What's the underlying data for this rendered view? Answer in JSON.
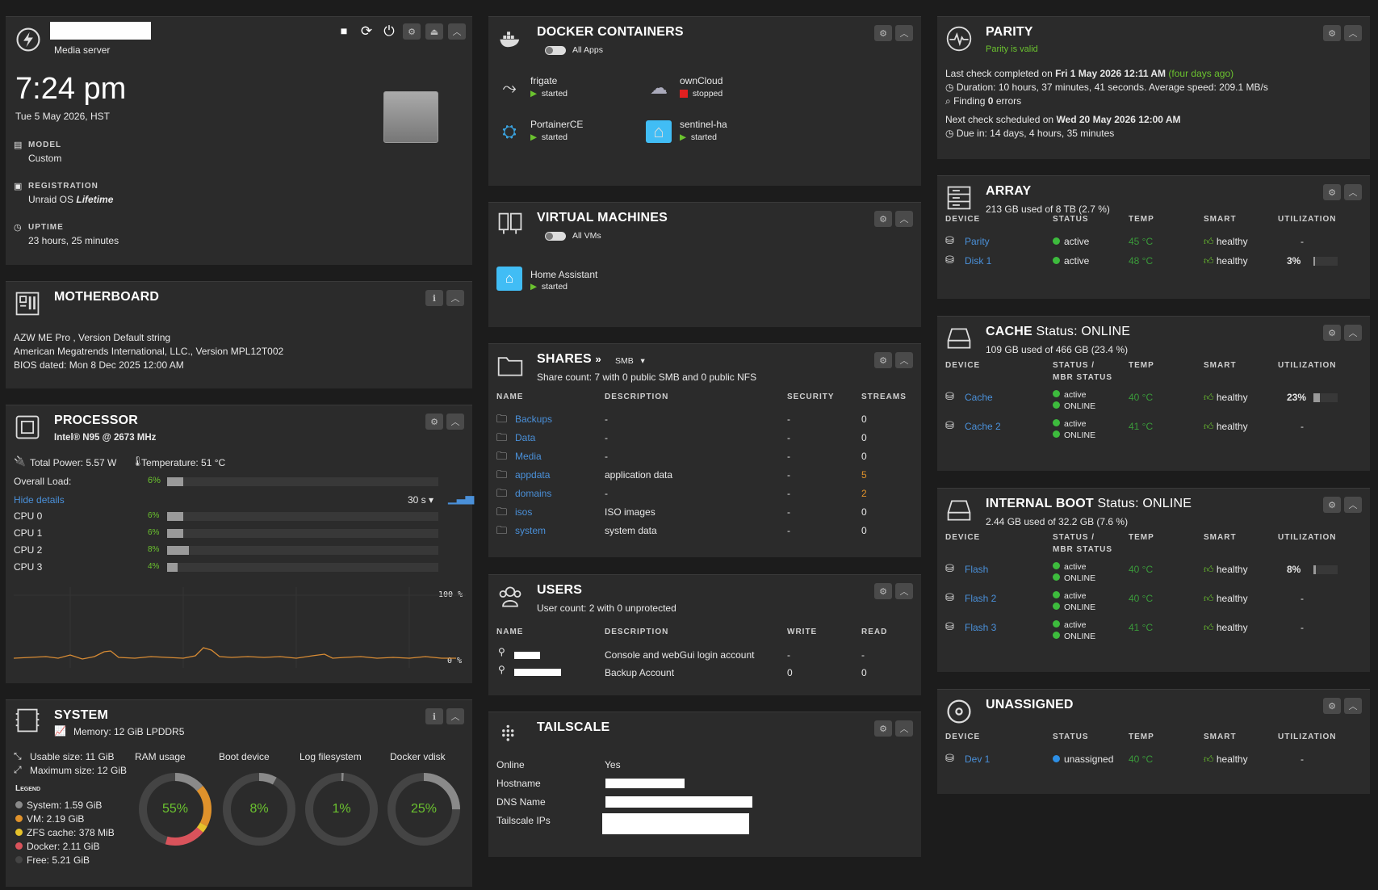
{
  "server": {
    "description": "Media server",
    "time": "7:24 pm",
    "date": "Tue 5 May 2026, HST",
    "model_label": "MODEL",
    "model_value": "Custom",
    "registration_label": "REGISTRATION",
    "registration_value_prefix": "Unraid OS",
    "registration_value_em": "Lifetime",
    "uptime_label": "UPTIME",
    "uptime_value": "23 hours, 25 minutes"
  },
  "motherboard": {
    "title": "MOTHERBOARD",
    "line1": "AZW ME Pro , Version Default string",
    "line2": "American Megatrends International, LLC., Version MPL12T002",
    "line3": "BIOS dated: Mon 8 Dec 2025 12:00 AM"
  },
  "processor": {
    "title": "PROCESSOR",
    "model": "Intel® N95 @ 2673 MHz",
    "power": "Total Power: 5.57 W",
    "temp": "Temperature: 51 °C",
    "overall_label": "Overall Load:",
    "overall_pct": "6%",
    "overall_value": 0.06,
    "hide_details": "Hide details",
    "interval": "30 s ▾",
    "cpus": [
      {
        "label": "CPU 0",
        "pct": "6%",
        "value": 0.06
      },
      {
        "label": "CPU 1",
        "pct": "6%",
        "value": 0.06
      },
      {
        "label": "CPU 2",
        "pct": "8%",
        "value": 0.08
      },
      {
        "label": "CPU 3",
        "pct": "4%",
        "value": 0.04
      }
    ],
    "graph_max": "100 %",
    "graph_min": "0 %"
  },
  "system": {
    "title": "SYSTEM",
    "memory": "Memory: 12 GiB LPDDR5",
    "usable": "Usable size: 11 GiB",
    "maximum": "Maximum size: 12 GiB",
    "legend_title": "Legend",
    "legend": [
      {
        "label": "System: 1.59 GiB",
        "color": "#8a8a8a"
      },
      {
        "label": "VM: 2.19 GiB",
        "color": "#e0922b"
      },
      {
        "label": "ZFS cache: 378 MiB",
        "color": "#e6c22b"
      },
      {
        "label": "Docker: 2.11 GiB",
        "color": "#d9535b"
      },
      {
        "label": "Free: 5.21 GiB",
        "color": "#444444"
      }
    ],
    "gauges": [
      {
        "label": "RAM usage",
        "value": "55%",
        "pct": 0.55
      },
      {
        "label": "Boot device",
        "value": "8%",
        "pct": 0.08
      },
      {
        "label": "Log filesystem",
        "value": "1%",
        "pct": 0.01
      },
      {
        "label": "Docker vdisk",
        "value": "25%",
        "pct": 0.25
      }
    ]
  },
  "docker": {
    "title": "DOCKER CONTAINERS",
    "toggle_label": "All Apps",
    "containers": [
      {
        "name": "frigate",
        "status": "started"
      },
      {
        "name": "ownCloud",
        "status": "stopped"
      },
      {
        "name": "PortainerCE",
        "status": "started"
      },
      {
        "name": "sentinel-ha",
        "status": "started"
      }
    ]
  },
  "vms": {
    "title": "VIRTUAL MACHINES",
    "toggle_label": "All VMs",
    "items": [
      {
        "name": "Home Assistant",
        "status": "started"
      }
    ]
  },
  "shares": {
    "title": "SHARES",
    "protocol": "SMB",
    "count": "Share count: 7 with 0 public SMB and 0 public NFS",
    "headers": [
      "NAME",
      "DESCRIPTION",
      "SECURITY",
      "STREAMS"
    ],
    "rows": [
      {
        "name": "Backups",
        "desc": "-",
        "sec": "-",
        "streams": "0"
      },
      {
        "name": "Data",
        "desc": "-",
        "sec": "-",
        "streams": "0"
      },
      {
        "name": "Media",
        "desc": "-",
        "sec": "-",
        "streams": "0"
      },
      {
        "name": "appdata",
        "desc": "application data",
        "sec": "-",
        "streams": "5"
      },
      {
        "name": "domains",
        "desc": "-",
        "sec": "-",
        "streams": "2"
      },
      {
        "name": "isos",
        "desc": "ISO images",
        "sec": "-",
        "streams": "0"
      },
      {
        "name": "system",
        "desc": "system data",
        "sec": "-",
        "streams": "0"
      }
    ]
  },
  "users": {
    "title": "USERS",
    "count": "User count: 2 with 0 unprotected",
    "headers": [
      "NAME",
      "DESCRIPTION",
      "WRITE",
      "READ"
    ],
    "rows": [
      {
        "desc": "Console and webGui login account",
        "write": "-",
        "read": "-"
      },
      {
        "desc": "Backup Account",
        "write": "0",
        "read": "0"
      }
    ]
  },
  "tailscale": {
    "title": "TAILSCALE",
    "rows": [
      {
        "label": "Online",
        "value": "Yes"
      },
      {
        "label": "Hostname",
        "value": ""
      },
      {
        "label": "DNS Name",
        "value": ""
      },
      {
        "label": "Tailscale IPs",
        "value": ""
      }
    ]
  },
  "parity": {
    "title": "PARITY",
    "status": "Parity is valid",
    "last_check_prefix": "Last check completed on",
    "last_check_date": "Fri 1 May 2026 12:11 AM",
    "last_check_ago": "(four days ago)",
    "duration": "Duration: 10 hours, 37 minutes, 41 seconds. Average speed: 209.1 MB/s",
    "finding_prefix": "Finding",
    "finding_count": "0",
    "finding_suffix": "errors",
    "next_prefix": "Next check scheduled on",
    "next_date": "Wed 20 May 2026 12:00 AM",
    "due": "Due in: 14 days, 4 hours, 35 minutes"
  },
  "array": {
    "title": "ARRAY",
    "usage": "213 GB used of 8 TB (2.7 %)",
    "headers": [
      "DEVICE",
      "STATUS",
      "TEMP",
      "SMART",
      "UTILIZATION"
    ],
    "rows": [
      {
        "device": "Parity",
        "status": "active",
        "temp": "45 °C",
        "smart": "healthy",
        "util": "-"
      },
      {
        "device": "Disk 1",
        "status": "active",
        "temp": "48 °C",
        "smart": "healthy",
        "util": "3%"
      }
    ]
  },
  "cache": {
    "title": "CACHE",
    "title_status": "Status: ONLINE",
    "usage": "109 GB used of 466 GB (23.4 %)",
    "headers": [
      "DEVICE",
      "STATUS /",
      "MBR STATUS",
      "TEMP",
      "SMART",
      "UTILIZATION"
    ],
    "rows": [
      {
        "device": "Cache",
        "status": "active",
        "mbr": "ONLINE",
        "temp": "40 °C",
        "smart": "healthy",
        "util": "23%"
      },
      {
        "device": "Cache 2",
        "status": "active",
        "mbr": "ONLINE",
        "temp": "41 °C",
        "smart": "healthy",
        "util": "-"
      }
    ]
  },
  "boot": {
    "title": "INTERNAL BOOT",
    "title_status": "Status: ONLINE",
    "usage": "2.44 GB used of 32.2 GB (7.6 %)",
    "headers": [
      "DEVICE",
      "STATUS /",
      "MBR STATUS",
      "TEMP",
      "SMART",
      "UTILIZATION"
    ],
    "rows": [
      {
        "device": "Flash",
        "status": "active",
        "mbr": "ONLINE",
        "temp": "40 °C",
        "smart": "healthy",
        "util": "8%"
      },
      {
        "device": "Flash 2",
        "status": "active",
        "mbr": "ONLINE",
        "temp": "40 °C",
        "smart": "healthy",
        "util": "-"
      },
      {
        "device": "Flash 3",
        "status": "active",
        "mbr": "ONLINE",
        "temp": "41 °C",
        "smart": "healthy",
        "util": "-"
      }
    ]
  },
  "unassigned": {
    "title": "UNASSIGNED",
    "headers": [
      "DEVICE",
      "STATUS",
      "TEMP",
      "SMART",
      "UTILIZATION"
    ],
    "rows": [
      {
        "device": "Dev 1",
        "status": "unassigned",
        "temp": "40 °C",
        "smart": "healthy",
        "util": "-"
      }
    ]
  },
  "colors": {
    "accent_green": "#6bc32f",
    "link_blue": "#4a90d9",
    "warn_orange": "#e0922b",
    "stopped_red": "#e02020",
    "unassigned_blue": "#2d8fe6"
  }
}
